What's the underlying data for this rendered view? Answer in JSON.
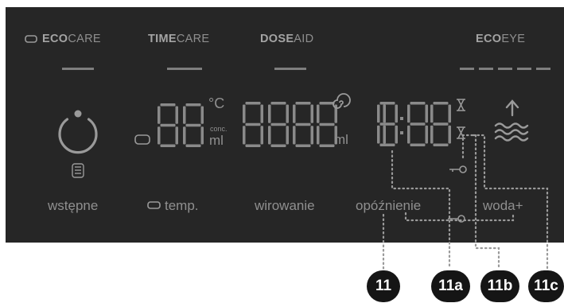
{
  "colors": {
    "panel": "#262626",
    "segment": "#8a8a8a",
    "text": "#8f8f8f",
    "callout": "#151515",
    "leader": "#9a9a9a"
  },
  "brands": {
    "ecocare": {
      "bold": "ECO",
      "rest": "CARE",
      "icon": "rounded-rect-icon"
    },
    "timecare": {
      "bold": "TIME",
      "rest": "CARE"
    },
    "doseaid": {
      "bold": "DOSE",
      "rest": "AID"
    },
    "ecoeye": {
      "bold": "ECO",
      "rest": "EYE"
    }
  },
  "display": {
    "temp_unit": "°C",
    "conc_label": "conc.",
    "ml_label_1": "ml",
    "ml_label_2": "ml",
    "time_readout": "18:88"
  },
  "icons": [
    "power-arc-icon",
    "detergent-cup-icon",
    "spiral-icon",
    "hourglass-icon",
    "key-lock-icon",
    "water-plus-icon",
    "rounded-rect-icon"
  ],
  "labels": {
    "wstepne": "wstępne",
    "temp": "temp.",
    "wirowanie": "wirowanie",
    "opoznienie": "opóźnienie",
    "woda": "woda+"
  },
  "callouts": [
    "11",
    "11a",
    "11b",
    "11c"
  ]
}
